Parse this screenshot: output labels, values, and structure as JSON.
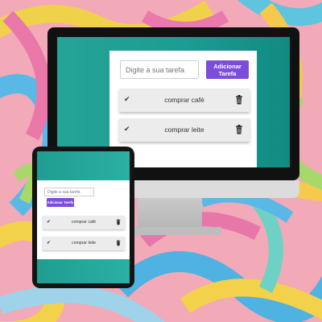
{
  "desktop": {
    "input_placeholder": "Digite a sua tarefa",
    "add_button_label": "Adicionar Tarefa",
    "tasks": [
      {
        "label": "comprar café",
        "done_icon": "check-icon",
        "delete_icon": "trash-icon"
      },
      {
        "label": "comprar leite",
        "done_icon": "check-icon",
        "delete_icon": "trash-icon"
      }
    ]
  },
  "tablet": {
    "input_placeholder": "Digite a sua tarefa",
    "add_button_label": "Adicionar Tarefa",
    "tasks": [
      {
        "label": "comprar café"
      },
      {
        "label": "comprar leite"
      }
    ]
  },
  "colors": {
    "accent": "#7c4ddb",
    "teal": "#1fa094",
    "item_bg": "#ececec"
  }
}
